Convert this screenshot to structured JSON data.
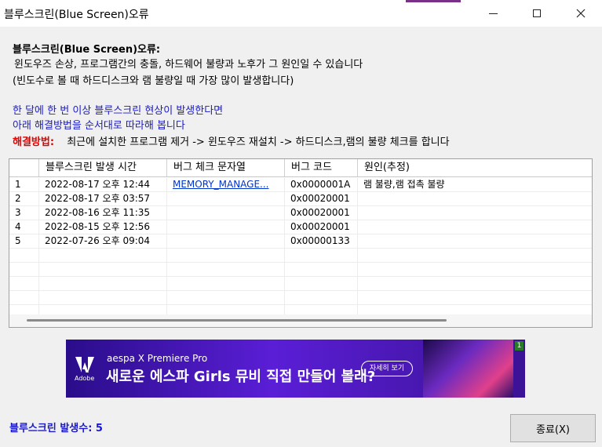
{
  "window": {
    "title": "블루스크린(Blue Screen)오류",
    "controls": {
      "minimize": "minimize-icon",
      "maximize": "maximize-icon",
      "close": "close-icon"
    }
  },
  "info": {
    "heading": "블루스크린(Blue Screen)오류:",
    "line1": "윈도우즈 손상, 프로그램간의 충돌, 하드웨어 불량과 노후가 그 원인일 수 있습니다",
    "line2": "(빈도수로 볼 때 하드디스크와 램 불량일 때 가장 많이 발생합니다)",
    "blue1": "한 달에 한 번 이상 블루스크린 현상이 발생한다면",
    "blue2": "아래 해결방법을 순서대로 따라해 봅니다",
    "solution_label": "해결방법:",
    "solution_text": "최근에 설치한 프로그램 제거 -> 윈도우즈 재설치 -> 하드디스크,램의 불량 체크를 합니다"
  },
  "table": {
    "headers": [
      "",
      "블루스크린 발생 시간",
      "버그 체크 문자열",
      "버그 코드",
      "원인(추정)"
    ],
    "rows": [
      [
        "1",
        "2022-08-17 오후 12:44",
        "MEMORY_MANAGE...",
        "0x0000001A",
        "램 불량,램 접촉 불량"
      ],
      [
        "2",
        "2022-08-17 오후 03:57",
        "",
        "0x00020001",
        ""
      ],
      [
        "3",
        "2022-08-16 오후 11:35",
        "",
        "0x00020001",
        ""
      ],
      [
        "4",
        "2022-08-15 오후 12:56",
        "",
        "0x00020001",
        ""
      ],
      [
        "5",
        "2022-07-26 오후 09:04",
        "",
        "0x00000133",
        ""
      ],
      [
        "",
        "",
        "",
        "",
        ""
      ],
      [
        "",
        "",
        "",
        "",
        ""
      ],
      [
        "",
        "",
        "",
        "",
        ""
      ],
      [
        "",
        "",
        "",
        "",
        ""
      ],
      [
        "",
        "",
        "",
        "",
        ""
      ]
    ]
  },
  "ad": {
    "brand": "Adobe",
    "subtitle": "aespa X Premiere Pro",
    "headline": "새로운 에스파 Girls 뮤비 직접 만들어 볼래?",
    "cta": "자세히 보기",
    "badge": "1"
  },
  "status": {
    "text": "블루스크린 발생수: 5"
  },
  "buttons": {
    "close": "종료(X)"
  }
}
